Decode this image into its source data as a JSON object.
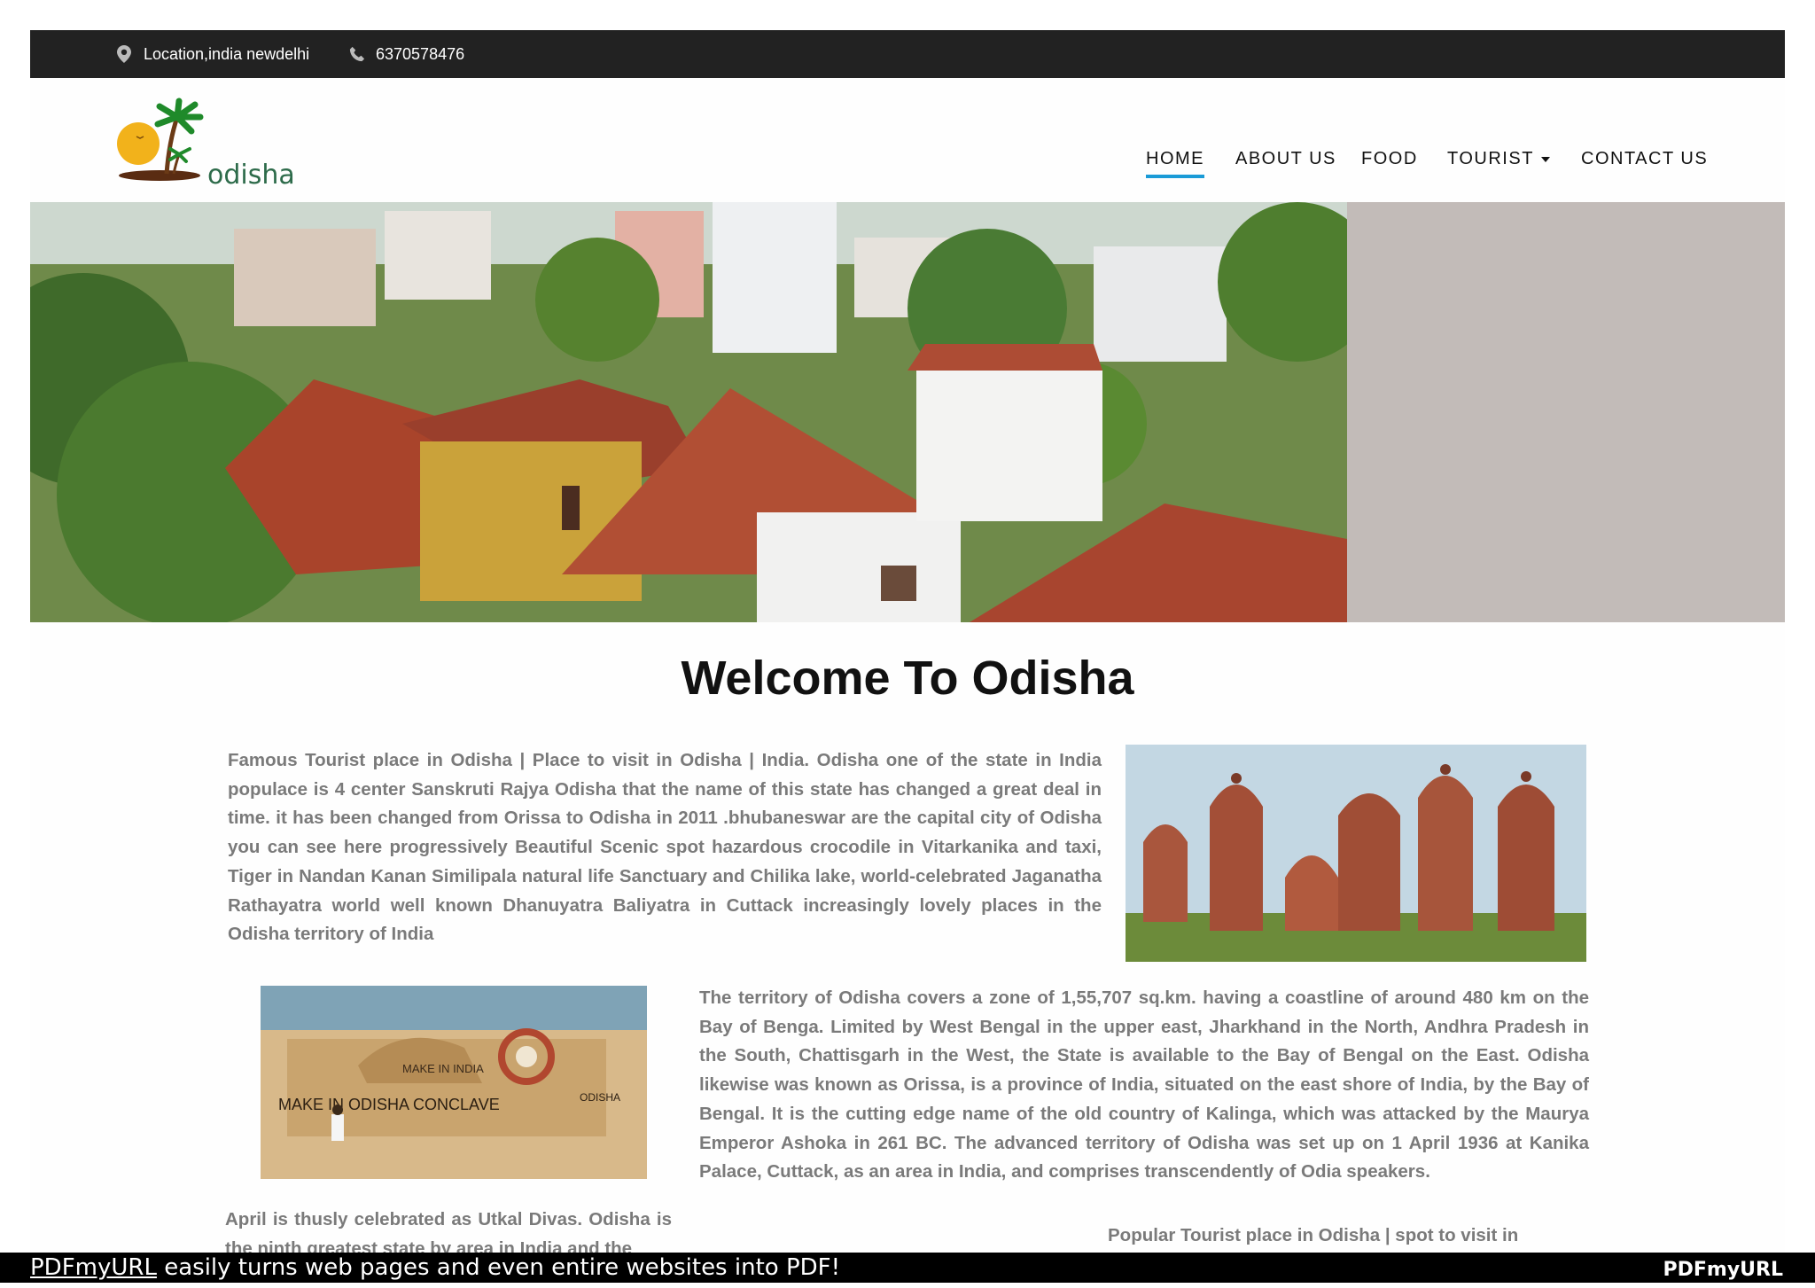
{
  "topbar": {
    "location_icon": "map-pin-icon",
    "location_text": "Location,india newdelhi",
    "phone_icon": "phone-icon",
    "phone_text": "6370578476"
  },
  "header": {
    "logo_text": "odisha",
    "nav": [
      "HOME",
      "ABOUT US",
      "FOOD",
      "TOURIST",
      "CONTACT US"
    ],
    "active": "HOME",
    "accent": "#1a6de8"
  },
  "main": {
    "title": "Welcome To Odisha",
    "para1": "Famous Tourist place in Odisha | Place to visit in Odisha | India. Odisha one of the state in India populace is 4 center Sanskruti Rajya Odisha that the name of this state has changed a great deal in time. it has been changed from Orissa to Odisha in 2011 .bhubaneswar are the capital city of Odisha you can see here progressively Beautiful Scenic spot hazardous crocodile in Vitarkanika and taxi, Tiger in Nandan Kanan Similipala natural life Sanctuary and Chilika lake, world-celebrated Jaganatha Rathayatra world well known Dhanuyatra Baliyatra in Cuttack increasingly lovely places in the Odisha territory of India",
    "para2": "The territory of Odisha covers a zone of 1,55,707 sq.km. having a coastline of around 480 km on the Bay of Benga. Limited by West Bengal in the upper east, Jharkhand in the North, Andhra Pradesh in the South, Chattisgarh in the West, the State is available to the Bay of Bengal on the East. Odisha likewise was known as Orissa, is a province of India, situated on the east shore of India, by the Bay of Bengal. It is the cutting edge name of the old country of Kalinga, which was attacked by the Maurya Emperor Ashoka in 261 BC. The advanced territory of Odisha was set up on 1 April 1936 at Kanika Palace, Cuttack, as an area in India, and comprises transcendently of Odia speakers.",
    "para3": "April is thusly celebrated as Utkal Divas. Odisha is the ninth greatest state by area in India and the",
    "para4": "Popular Tourist place in Odisha | spot to visit in",
    "sand_text1": "MAKE IN INDIA",
    "sand_text2": "MAKE IN ODISHA CONCLAVE",
    "sand_text3": "ODISHA"
  },
  "footer": {
    "link": "PDFmyURL",
    "text": " easily turns web pages and even entire websites into PDF!",
    "brand": "PDFmyURL"
  }
}
